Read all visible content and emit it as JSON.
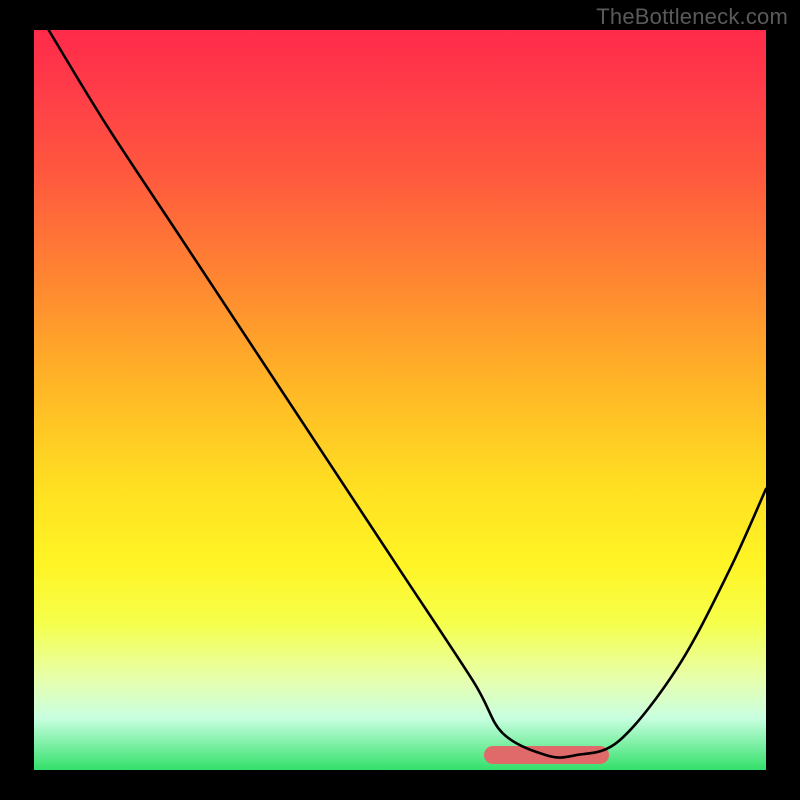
{
  "watermark": "TheBottleneck.com",
  "chart_data": {
    "type": "line",
    "title": "",
    "xlabel": "",
    "ylabel": "",
    "xlim": [
      0,
      100
    ],
    "ylim": [
      0,
      100
    ],
    "grid": false,
    "legend": false,
    "series": [
      {
        "name": "bottleneck-curve",
        "x": [
          2,
          10,
          20,
          30,
          40,
          50,
          60,
          64,
          70,
          74,
          80,
          88,
          95,
          100
        ],
        "values": [
          100,
          87,
          72,
          57,
          42,
          27,
          12,
          5,
          2,
          2,
          4,
          14,
          27,
          38
        ]
      }
    ],
    "optimal_zone": {
      "x_start": 62,
      "x_end": 78,
      "y": 2
    },
    "background_gradient": {
      "top": "#ff2a4a",
      "mid": "#ffe022",
      "bottom": "#33e06a"
    },
    "annotations": []
  }
}
